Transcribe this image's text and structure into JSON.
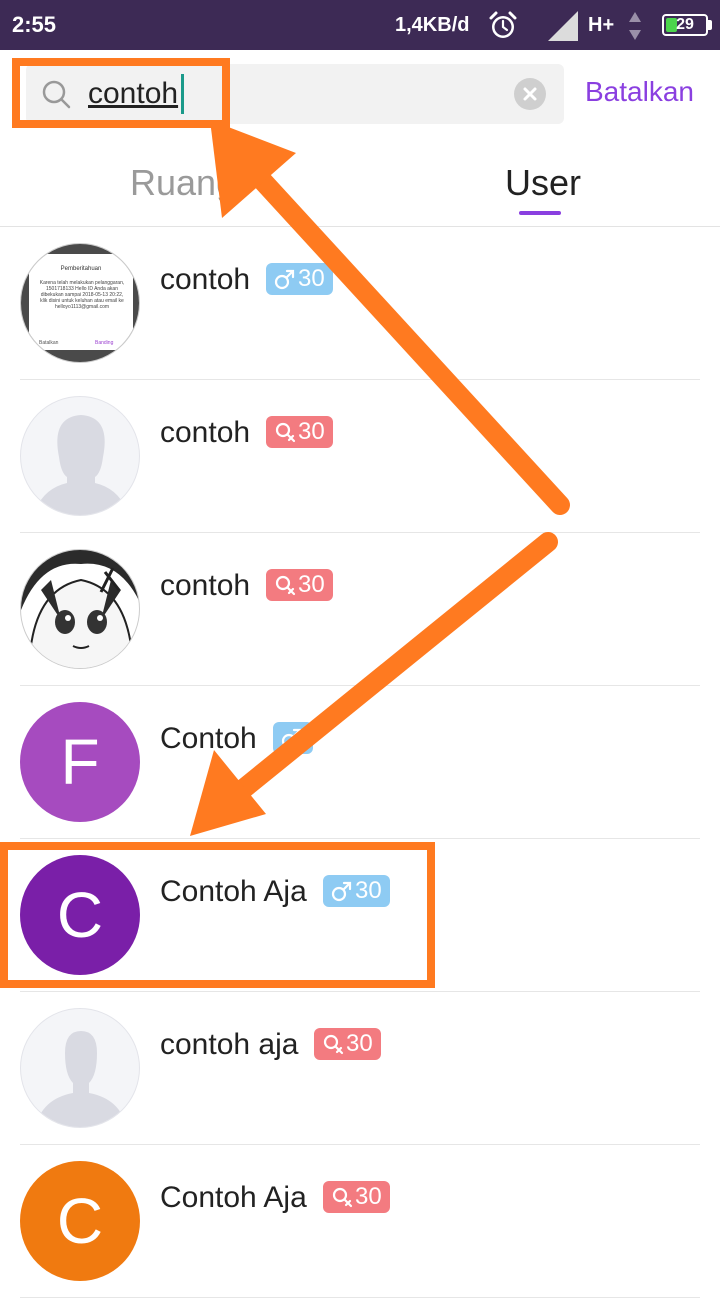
{
  "status_bar": {
    "time": "2:55",
    "speed": "1,4KB/d",
    "network": "H+",
    "battery": "29",
    "battery_level": 0.29
  },
  "search": {
    "value": "contoh",
    "cancel_label": "Batalkan"
  },
  "tabs": [
    {
      "label": "Ruang",
      "active": false
    },
    {
      "label": "User",
      "active": true
    }
  ],
  "notification_thumb": {
    "title": "Pemberitahuan",
    "body": "Karena telah melakukan pelanggaran, 1501718133 Hello ID Anda akan dibekukan sampai 2018-05-13 20:22, klik disini untuk keluhan atau email ke helloyo1113@gmail.com",
    "cancel": "Batalkan",
    "appeal": "Banding"
  },
  "users": [
    {
      "name": "contoh",
      "gender": "male",
      "age": "30",
      "avatar": "notification-screenshot"
    },
    {
      "name": "contoh",
      "gender": "female",
      "age": "30",
      "avatar": "default-female"
    },
    {
      "name": "contoh",
      "gender": "female",
      "age": "30",
      "avatar": "anime-sketch"
    },
    {
      "name": "Contoh",
      "gender": "male",
      "age": "",
      "avatar": "letter",
      "letter": "F",
      "color": "#a64bbf"
    },
    {
      "name": "Contoh Aja",
      "gender": "male",
      "age": "30",
      "avatar": "letter",
      "letter": "C",
      "color": "#7a1fa8"
    },
    {
      "name": "contoh aja",
      "gender": "female",
      "age": "30",
      "avatar": "default-male"
    },
    {
      "name": "Contoh Aja",
      "gender": "female",
      "age": "30",
      "avatar": "letter",
      "letter": "C",
      "color": "#f07a10"
    }
  ],
  "colors": {
    "accent": "#8a3fe0",
    "annotation": "#ff7a20",
    "male_badge": "#8ecbf3",
    "female_badge": "#f37b80"
  }
}
